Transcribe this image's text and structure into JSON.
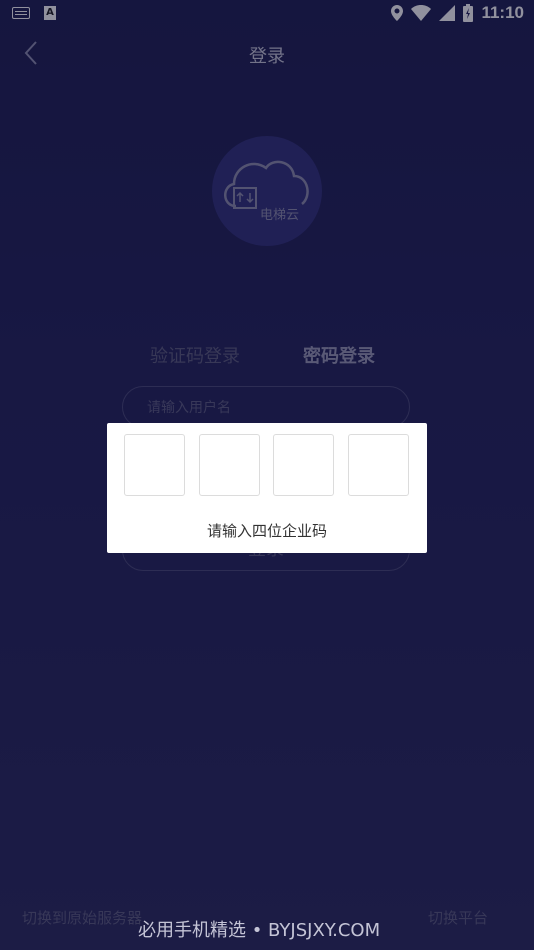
{
  "status_bar": {
    "time": "11:10",
    "icons": [
      "keyboard-icon",
      "a-badge-icon",
      "location-icon",
      "wifi-icon",
      "signal-icon",
      "battery-icon"
    ],
    "a_badge": "A"
  },
  "header": {
    "title": "登录",
    "back_icon": "chevron-left-icon"
  },
  "logo": {
    "text": "电梯云"
  },
  "tabs": [
    {
      "label": "验证码登录",
      "active": false
    },
    {
      "label": "密码登录",
      "active": true
    }
  ],
  "form": {
    "username_placeholder": "请输入用户名",
    "login_label": "登录"
  },
  "dialog": {
    "boxes": [
      "",
      "",
      "",
      ""
    ],
    "hint": "请输入四位企业码"
  },
  "footer": {
    "left_link": "切换到原始服务器",
    "right_link": "切换平台"
  },
  "watermark": "必用手机精选 • BYJSJXY.COM",
  "colors": {
    "background": "#23235a",
    "logo_circle": "#32327a",
    "dialog": "#ffffff"
  }
}
